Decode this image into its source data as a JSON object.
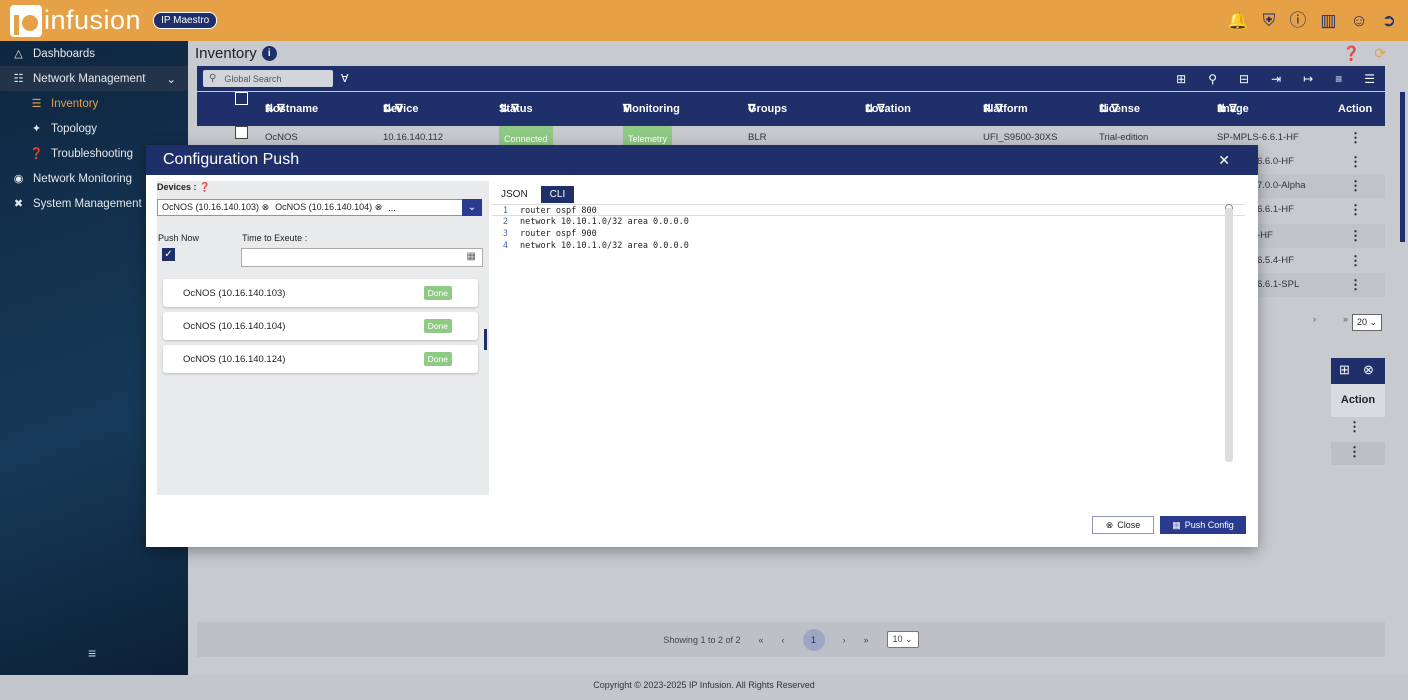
{
  "app": {
    "brand": "infusion",
    "badge": "IP Maestro",
    "accent": "#e6a046",
    "navy": "#1e2f6a"
  },
  "top_icons": [
    "bell-icon",
    "shield-icon",
    "info-icon",
    "book-icon",
    "user-icon",
    "logout-icon"
  ],
  "sidebar": {
    "items": [
      {
        "label": "Dashboards",
        "icon": "dashboard-icon"
      },
      {
        "label": "Network Management",
        "icon": "network-icon"
      },
      {
        "label": "Inventory",
        "icon": "inventory-icon"
      },
      {
        "label": "Topology",
        "icon": "topology-icon"
      },
      {
        "label": "Troubleshooting",
        "icon": "question-icon"
      },
      {
        "label": "Network Monitoring",
        "icon": "monitor-icon"
      },
      {
        "label": "System Management",
        "icon": "tools-icon"
      }
    ]
  },
  "main": {
    "title": "Inventory",
    "search_placeholder": "Global Search",
    "columns": [
      "Hostname",
      "Device",
      "Status",
      "Monitoring",
      "Groups",
      "Location",
      "Platform",
      "License",
      "Image",
      "Action"
    ],
    "row1": {
      "hostname": "OcNOS",
      "device": "10.16.140.112",
      "status": "Connected",
      "monitoring": "Telemetry",
      "groups": "BLR",
      "location": "",
      "platform": "UFI_S9500-30XS",
      "license": "Trial-edition",
      "image": "SP-MPLS-6.6.1-HF"
    },
    "image_partials": [
      "6.6.0-HF",
      "7.0.0-Alpha",
      "6.6.1-HF",
      "-HF",
      "6.5.4-HF",
      "6.6.1-SPL"
    ],
    "page_size": "20",
    "panel2_action": "Action",
    "pager_text": "Showing 1 to 2 of 2",
    "pager_current": "1",
    "pager_size": "10"
  },
  "modal": {
    "title": "Configuration Push",
    "devices_label": "Devices :",
    "chips": [
      "OcNOS (10.16.140.103)",
      "OcNOS (10.16.140.104)"
    ],
    "chip_more": "...",
    "push_now_label": "Push Now",
    "time_label": "Time to Exeute :",
    "device_status": [
      {
        "name": "OcNOS (10.16.140.103)",
        "status": "Done"
      },
      {
        "name": "OcNOS (10.16.140.104)",
        "status": "Done"
      },
      {
        "name": "OcNOS (10.16.140.124)",
        "status": "Done"
      }
    ],
    "tabs": [
      "JSON",
      "CLI"
    ],
    "code_lines": [
      "router ospf 800",
      "network 10.10.1.0/32 area 0.0.0.0",
      "router ospf 900",
      "network 10.10.1.0/32 area 0.0.0.0"
    ],
    "close_label": "Close",
    "push_label": "Push Config"
  },
  "footer": "Copyright © 2023-2025 IP Infusion. All Rights Reserved"
}
